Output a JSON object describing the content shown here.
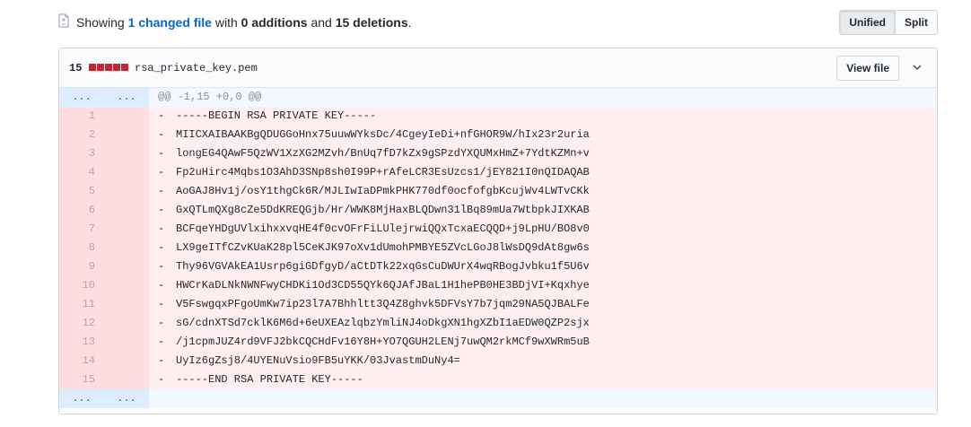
{
  "summary": {
    "prefix": "Showing",
    "changed_link": "1 changed file",
    "with": "with",
    "additions": "0 additions",
    "and": "and",
    "deletions": "15 deletions",
    "suffix": "."
  },
  "view_toggle": {
    "unified": "Unified",
    "split": "Split",
    "selected": "Unified"
  },
  "file": {
    "diffstat_count": "15",
    "diffstat_blocks": 5,
    "name": "rsa_private_key.pem",
    "view_file_label": "View file"
  },
  "hunk": {
    "expander": "...",
    "header": "@@ -1,15 +0,0 @@"
  },
  "colors": {
    "deleted_bg": "#ffeef0",
    "deleted_num_bg": "#ffdce0",
    "hunk_bg": "#f1f8ff",
    "link": "#0366d6",
    "diffstat_red": "#cb2431"
  },
  "lines": [
    {
      "n": "1",
      "marker": "-",
      "text": "-----BEGIN RSA PRIVATE KEY-----"
    },
    {
      "n": "2",
      "marker": "-",
      "text": "MIICXAIBAAKBgQDUGGoHnx75uuwWYksDc/4CgeyIeDi+nfGHOR9W/hIx23r2uria"
    },
    {
      "n": "3",
      "marker": "-",
      "text": "longEG4QAwF5QzWV1XzXG2MZvh/BnUq7fD7kZx9gSPzdYXQUMxHmZ+7YdtKZMn+v"
    },
    {
      "n": "4",
      "marker": "-",
      "text": "Fp2uHirc4Mqbs1O3AhD3SNp8sh0I99P+rAfeLCR3EsUzcs1/jEY821I0nQIDAQAB"
    },
    {
      "n": "5",
      "marker": "-",
      "text": "AoGAJ8Hv1j/osY1thgCk6R/MJLIwIaDPmkPHK770df0ocfofgbKcujWv4LWTvCKk"
    },
    {
      "n": "6",
      "marker": "-",
      "text": "GxQTLmQXg8cZe5DdKREQGjb/Hr/WWK8MjHaxBLQDwn31lBq89mUa7WtbpkJIXKAB"
    },
    {
      "n": "7",
      "marker": "-",
      "text": "BCFqeYHDgUVlxihxxvqHE4f0cvOFrFiLUlejrwiQQxTcxaECQQD+j9LpHU/BO8v0"
    },
    {
      "n": "8",
      "marker": "-",
      "text": "LX9geITfCZvKUaK28pl5CeKJK97oXv1dUmohPMBYE5ZVcLGoJ8lWsDQ9dAt8gw6s"
    },
    {
      "n": "9",
      "marker": "-",
      "text": "Thy96VGVAkEA1Usrp6giGDfgyD/aCtDTk22xqGsCuDWUrX4wqRBogJvbku1f5U6v"
    },
    {
      "n": "10",
      "marker": "-",
      "text": "HWCrKaDLNkNWNFwyCHDKi1Od3CD55QYk6QJAfJBaL1H1hePB0HE3BDjVI+Kqxhye"
    },
    {
      "n": "11",
      "marker": "-",
      "text": "V5FswgqxPFgoUmKw7ip23l7A7Bhhltt3Q4Z8ghvk5DFVsY7b7jqm29NA5QJBALFe"
    },
    {
      "n": "12",
      "marker": "-",
      "text": "sG/cdnXTSd7cklK6M6d+6eUXEAzlqbzYmliNJ4oDkgXN1hgXZbI1aEDW0QZP2sjx"
    },
    {
      "n": "13",
      "marker": "-",
      "text": "/j1cpmJUZ4rd9VFJ2bkCQCHdFv16Y8H+YO7QGUH2LENj7uwQM2rkMCf9wXWRm5uB"
    },
    {
      "n": "14",
      "marker": "-",
      "text": "UyIz6gZsj8/4UYENuVsio9FB5uYKK/03JvastmDuNy4="
    },
    {
      "n": "15",
      "marker": "-",
      "text": "-----END RSA PRIVATE KEY-----"
    }
  ]
}
